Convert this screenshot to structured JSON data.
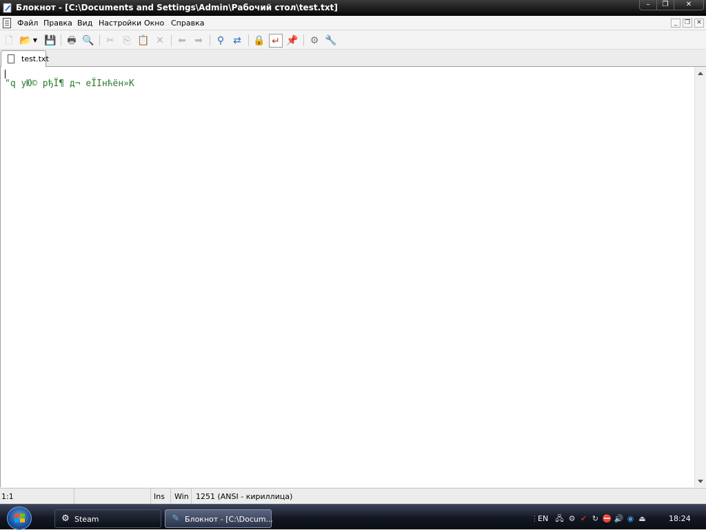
{
  "window": {
    "title": "Блокнот - [C:\\Documents and Settings\\Admin\\Рабочий стол\\test.txt]",
    "minimize": "–",
    "maximize": "❐",
    "close": "✕"
  },
  "menu": {
    "items": [
      "Файл",
      "Правка",
      "Вид",
      "Настройки",
      "Окно",
      "Справка"
    ],
    "mdi_min": "_",
    "mdi_restore": "❐",
    "mdi_close": "✕"
  },
  "toolbar": {
    "icons": [
      "new-file-icon",
      "open-folder-icon",
      "dropdown-arrow-icon",
      "save-icon",
      "print-icon",
      "print-preview-icon",
      "cut-icon",
      "copy-icon",
      "paste-icon",
      "delete-icon",
      "undo-icon",
      "redo-icon",
      "find-icon",
      "replace-icon",
      "lock-icon",
      "word-wrap-icon",
      "pin-icon",
      "settings-icon",
      "tools-icon"
    ]
  },
  "tabs": [
    {
      "label": "test.txt",
      "active": true
    }
  ],
  "editor": {
    "content": "\"q уЮ© рђЇ¶ д¬ еЇІнћён»К"
  },
  "status": {
    "position": "1:1",
    "blank": "",
    "mode": "Ins",
    "line_endings": "Win",
    "encoding": "1251  (ANSI - кириллица)"
  },
  "taskbar": {
    "items": [
      {
        "label": "Steam",
        "icon": "steam-icon",
        "active": false
      },
      {
        "label": "Блокнот - [C:\\Docum...",
        "icon": "notepad-icon",
        "active": true
      }
    ],
    "language": "EN",
    "clock": "18:24",
    "tray_icons": [
      "network-icon",
      "steam-tray-icon",
      "display-icon",
      "antivirus-icon",
      "update-icon",
      "security-icon",
      "volume-icon",
      "media-icon",
      "safely-remove-icon"
    ]
  },
  "colors": {
    "titlebar": "#0a0a0a",
    "text_green": "#2a7a2a",
    "taskbar": "#121722"
  }
}
